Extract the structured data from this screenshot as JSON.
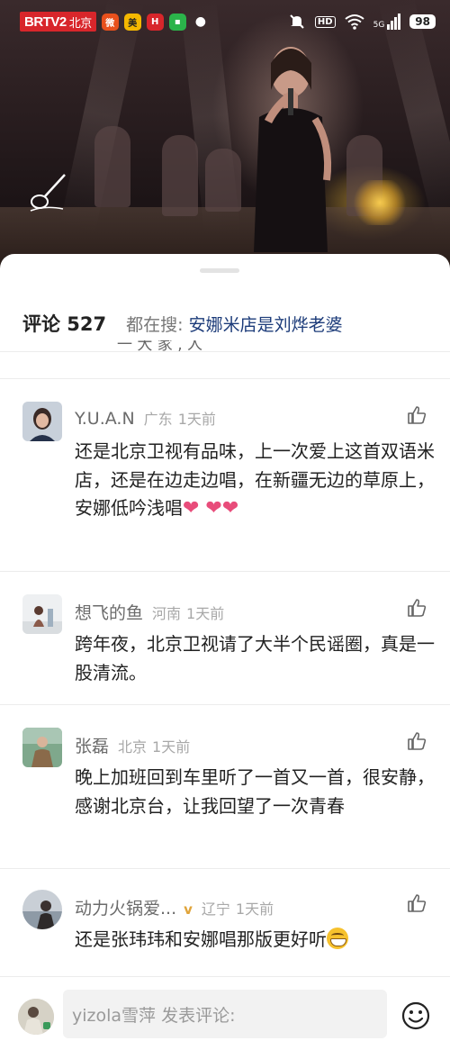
{
  "status_bar": {
    "channel": "BRTV2",
    "city": "北京",
    "hd": "HD",
    "network": "5G",
    "battery": "98",
    "apps": [
      {
        "icon": "weibo-icon",
        "color": "#e8501c"
      },
      {
        "icon": "meituan-icon",
        "color": "#f5b800"
      },
      {
        "icon": "huawei-app-icon",
        "color": "#d8262b"
      },
      {
        "icon": "wechat-icon",
        "color": "#2bb34a"
      }
    ]
  },
  "sheet": {
    "comment_count_label": "评论 527",
    "hot_search_prefix": "都在搜:",
    "hot_search_link": "安娜米店是刘烨老婆",
    "partial_text": "一 大 家 , 人"
  },
  "comments": [
    {
      "name": "Y.U.A.N",
      "region": "广东",
      "time": "1天前",
      "text": "还是北京卫视有品味，上一次爱上这首双语米店，还是在边走边唱，在新疆无边的草原上，安娜低吟浅唱",
      "hearts": "❤ ❤❤"
    },
    {
      "name": "想飞的鱼",
      "region": "河南",
      "time": "1天前",
      "text": "跨年夜，北京卫视请了大半个民谣圈，真是一股清流。"
    },
    {
      "name": "张磊",
      "region": "北京",
      "time": "1天前",
      "text": "晚上加班回到车里听了一首又一首，很安静，感谢北京台，让我回望了一次青春"
    },
    {
      "name": "动力火锅爱...",
      "badge": "🅥",
      "region": "辽宁",
      "time": "1天前",
      "text": "还是张玮玮和安娜唱那版更好听"
    }
  ],
  "input_bar": {
    "placeholder": "yizola雪萍 发表评论:"
  },
  "colors": {
    "accent_link": "#1d3c7a",
    "heart": "#e84c7a"
  }
}
